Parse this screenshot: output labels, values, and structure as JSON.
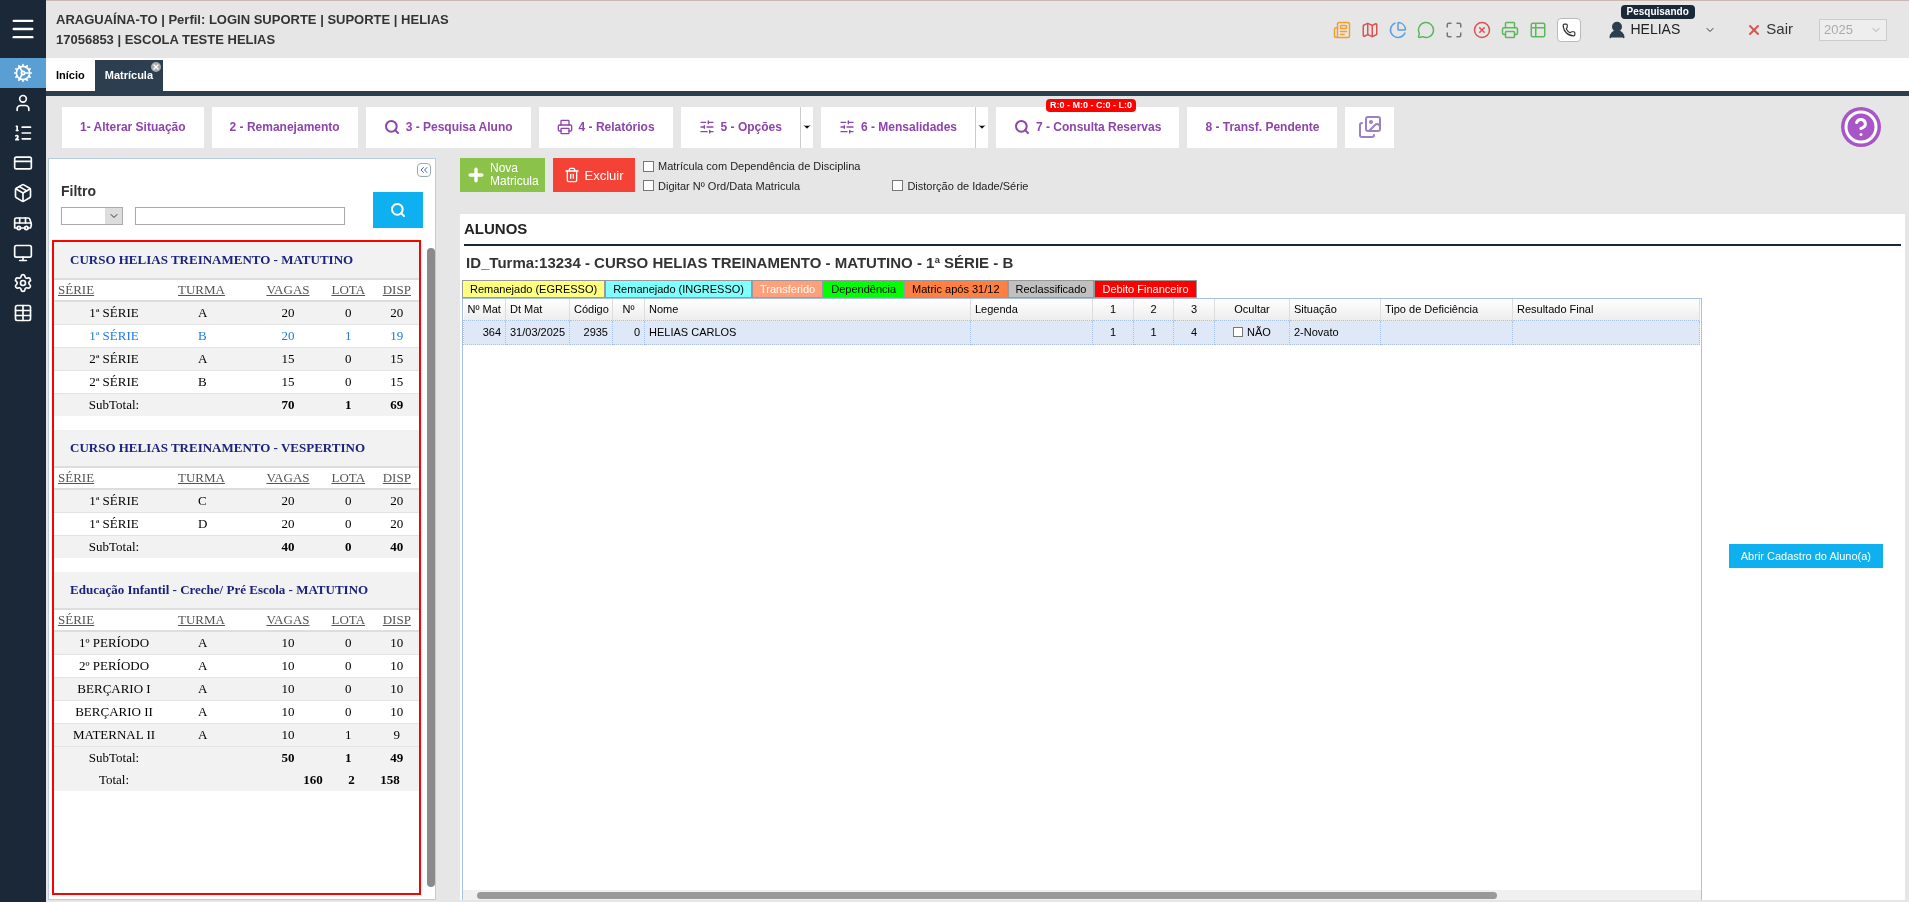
{
  "header": {
    "line_1": "ARAGUAÍNA-TO | Perfil: LOGIN SUPORTE | SUPORTE | HELIAS",
    "line_2": "17056853 | ESCOLA TESTE HELIAS",
    "user": "HELIAS",
    "user_tooltip": "Pesquisando",
    "logout": "Sair",
    "year": "2025"
  },
  "tabs": [
    {
      "label": "Início",
      "selected": false,
      "closable": false
    },
    {
      "label": "Matrícula",
      "selected": true,
      "closable": true
    }
  ],
  "toolbar": [
    {
      "label": "1- Alterar Situação",
      "kind": "plain"
    },
    {
      "label": "2 - Remanejamento",
      "kind": "plain"
    },
    {
      "label": "3 - Pesquisa Aluno",
      "kind": "search"
    },
    {
      "label": "4 - Relatórios",
      "kind": "print"
    },
    {
      "label": "5 - Opções",
      "kind": "dropdown"
    },
    {
      "label": "6 - Mensalidades",
      "kind": "dropdown"
    },
    {
      "label": "7 - Consulta Reservas",
      "kind": "search",
      "badge": "R:0 - M:0 - C:0 - L:0"
    },
    {
      "label": "8 - Transf. Pendente",
      "kind": "plain"
    },
    {
      "kind": "image"
    }
  ],
  "filter": {
    "label": "Filtro"
  },
  "groups": [
    {
      "title": "CURSO HELIAS TREINAMENTO - MATUTINO",
      "columns": [
        "SÉRIE",
        "TURMA",
        "VAGAS",
        "LOTA",
        "DISP"
      ],
      "rows": [
        {
          "serie": "1ª SÉRIE",
          "turma": "A",
          "vagas": "20",
          "lota": "0",
          "disp": "20",
          "selected": false
        },
        {
          "serie": "1ª SÉRIE",
          "turma": "B",
          "vagas": "20",
          "lota": "1",
          "disp": "19",
          "selected": true
        },
        {
          "serie": "2ª SÉRIE",
          "turma": "A",
          "vagas": "15",
          "lota": "0",
          "disp": "15",
          "selected": false
        },
        {
          "serie": "2ª SÉRIE",
          "turma": "B",
          "vagas": "15",
          "lota": "0",
          "disp": "15",
          "selected": false
        }
      ],
      "subtotal": {
        "label": "SubTotal:",
        "vagas": "70",
        "lota": "1",
        "disp": "69"
      }
    },
    {
      "title": "CURSO HELIAS TREINAMENTO - VESPERTINO",
      "columns": [
        "SÉRIE",
        "TURMA",
        "VAGAS",
        "LOTA",
        "DISP"
      ],
      "rows": [
        {
          "serie": "1ª SÉRIE",
          "turma": "C",
          "vagas": "20",
          "lota": "0",
          "disp": "20",
          "selected": false
        },
        {
          "serie": "1ª SÉRIE",
          "turma": "D",
          "vagas": "20",
          "lota": "0",
          "disp": "20",
          "selected": false
        }
      ],
      "subtotal": {
        "label": "SubTotal:",
        "vagas": "40",
        "lota": "0",
        "disp": "40"
      }
    },
    {
      "title": "Educação Infantil - Creche/ Pré Escola - MATUTINO",
      "columns": [
        "SÉRIE",
        "TURMA",
        "VAGAS",
        "LOTA",
        "DISP"
      ],
      "rows": [
        {
          "serie": "1º PERÍODO",
          "turma": "A",
          "vagas": "10",
          "lota": "0",
          "disp": "10",
          "selected": false
        },
        {
          "serie": "2º PERÍODO",
          "turma": "A",
          "vagas": "10",
          "lota": "0",
          "disp": "10",
          "selected": false
        },
        {
          "serie": "BERÇARIO I",
          "turma": "A",
          "vagas": "10",
          "lota": "0",
          "disp": "10",
          "selected": false
        },
        {
          "serie": "BERÇARIO II",
          "turma": "A",
          "vagas": "10",
          "lota": "0",
          "disp": "10",
          "selected": false
        },
        {
          "serie": "MATERNAL II",
          "turma": "A",
          "vagas": "10",
          "lota": "1",
          "disp": "9",
          "selected": false
        }
      ],
      "subtotal": {
        "label": "SubTotal:",
        "vagas": "50",
        "lota": "1",
        "disp": "49"
      }
    }
  ],
  "total": {
    "label": "Total:",
    "vagas": "160",
    "lota": "2",
    "disp": "158"
  },
  "actions": [
    {
      "label": "Nova Matricula",
      "kind": "add"
    },
    {
      "label": "Excluir",
      "kind": "delete"
    }
  ],
  "options": [
    {
      "label": "Matrícula com Dependência de Disciplina",
      "checked": false
    },
    {
      "label": "Digitar Nº Ord/Data Matricula",
      "checked": false
    },
    {
      "label": "Distorção de Idade/Série",
      "checked": false
    }
  ],
  "students": {
    "title": "ALUNOS",
    "class_title": "ID_Turma:13234 - CURSO HELIAS TREINAMENTO - MATUTINO - 1ª SÉRIE - B",
    "legend": [
      {
        "label": "Remanejado (EGRESSO)",
        "color": "#ffff80",
        "light_text": false
      },
      {
        "label": "Remanejado (INGRESSO)",
        "color": "#80ffff",
        "light_text": false
      },
      {
        "label": "Transferido",
        "color": "#ffa07a",
        "light_text": true
      },
      {
        "label": "Dependência",
        "color": "#00ff00",
        "light_text": false
      },
      {
        "label": "Matric após 31/12",
        "color": "#ff8040",
        "light_text": false
      },
      {
        "label": "Reclassificado",
        "color": "#c0c0c0",
        "light_text": false
      },
      {
        "label": "Debito Financeiro",
        "color": "#ff0000",
        "light_text": true
      }
    ],
    "columns": [
      "Nº Mat",
      "Dt Mat",
      "Código",
      "Nº",
      "Nome",
      "Legenda",
      "1",
      "2",
      "3",
      "Ocultar",
      "Situação",
      "Tipo de Deficiência",
      "Resultado Final"
    ],
    "rows": [
      {
        "num_mat": "364",
        "dt_mat": "31/03/2025",
        "codigo": "2935",
        "numero": "0",
        "nome": "HELIAS CARLOS",
        "n1": "1",
        "n2": "1",
        "n3": "4",
        "hidden": false,
        "hidden_label": "NÃO",
        "situacao": "2-Novato",
        "selected": true
      }
    ]
  },
  "open_record": "Abrir Cadastro do Aluno(a)"
}
